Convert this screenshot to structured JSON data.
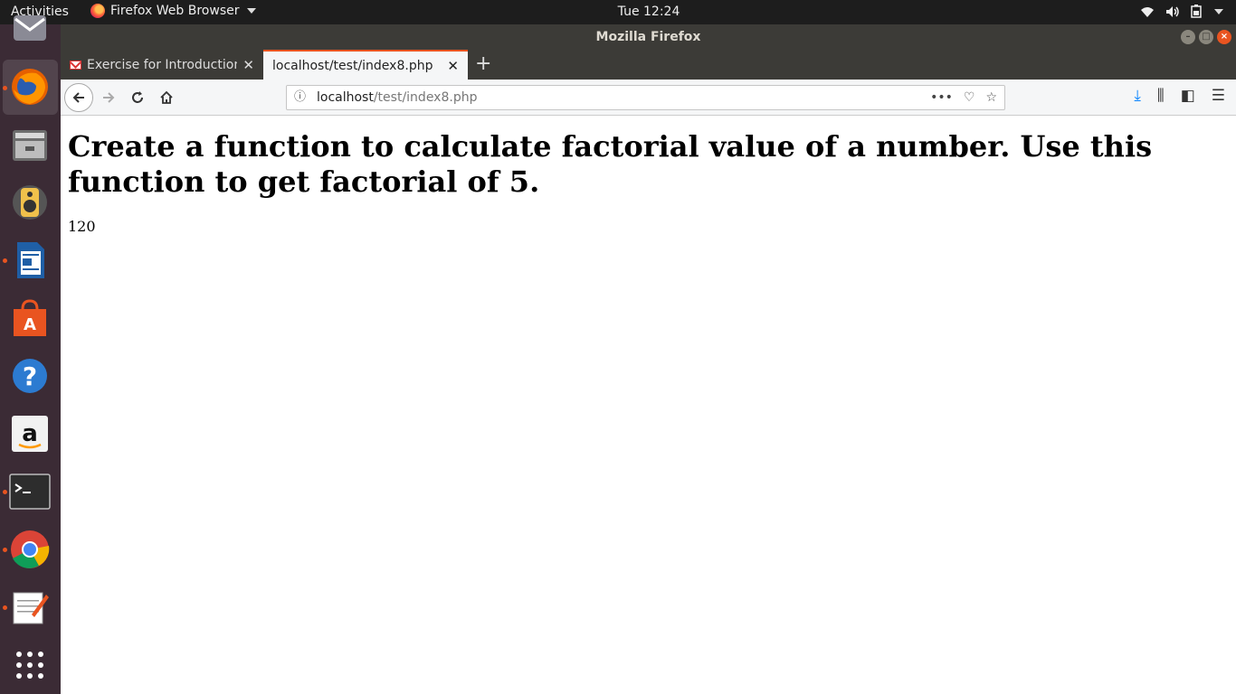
{
  "topbar": {
    "activities": "Activities",
    "app_menu": "Firefox Web Browser",
    "clock": "Tue 12:24"
  },
  "window": {
    "title": "Mozilla Firefox"
  },
  "tabs": [
    {
      "label": "Exercise for Introduction",
      "active": false,
      "icon": "gmail-icon"
    },
    {
      "label": "localhost/test/index8.php",
      "active": true
    }
  ],
  "navbar": {
    "url_host": "localhost",
    "url_path": "/test/index8.php"
  },
  "page": {
    "heading": "Create a function to calculate factorial value of a number. Use this function to get factorial of 5.",
    "result": "120"
  },
  "dock": [
    {
      "name": "files-icon"
    },
    {
      "name": "firefox-icon",
      "active": true
    },
    {
      "name": "file-manager-icon"
    },
    {
      "name": "rhythmbox-icon"
    },
    {
      "name": "libreoffice-writer-icon"
    },
    {
      "name": "software-center-icon"
    },
    {
      "name": "help-icon"
    },
    {
      "name": "amazon-icon"
    },
    {
      "name": "terminal-icon"
    },
    {
      "name": "chrome-icon"
    },
    {
      "name": "text-editor-icon"
    },
    {
      "name": "show-apps-icon"
    }
  ],
  "colors": {
    "accent": "#e95420",
    "topbar": "#1d1d1d",
    "titlebar": "#3c3b37"
  }
}
